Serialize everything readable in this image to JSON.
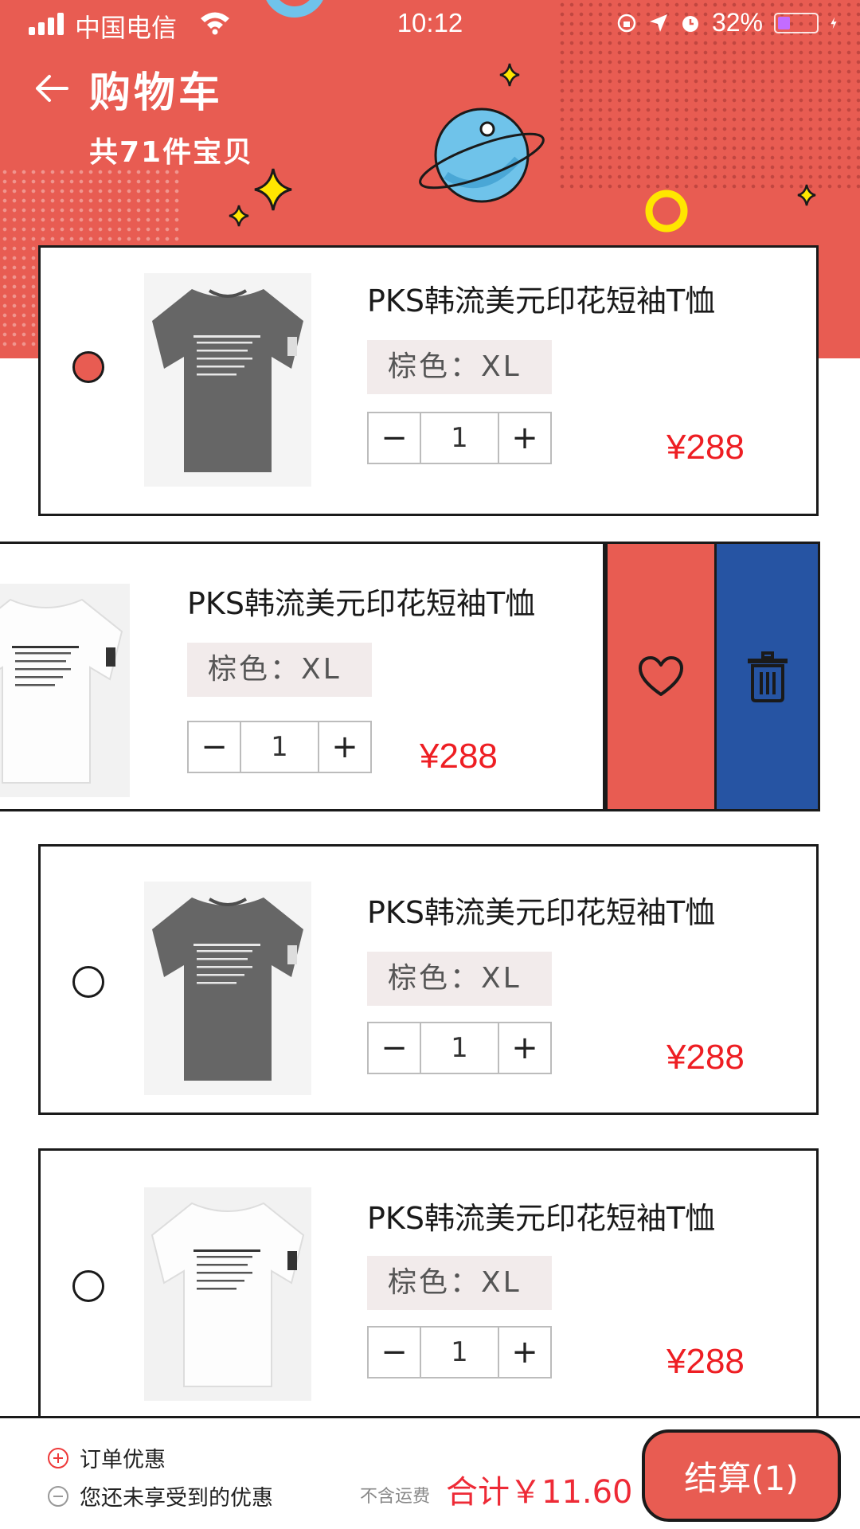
{
  "status_bar": {
    "carrier": "中国电信",
    "time": "10:12",
    "battery": "32%"
  },
  "header": {
    "title": "购物车",
    "subtitle": "共71件宝贝"
  },
  "items": [
    {
      "title": "PKS韩流美元印花短袖T恤",
      "spec": "棕色：XL",
      "qty": "1",
      "price": "¥288",
      "checked": true,
      "shirt_color": "grey"
    },
    {
      "title": "PKS韩流美元印花短袖T恤",
      "spec": "棕色：XL",
      "qty": "1",
      "price": "¥288",
      "checked": false,
      "shirt_color": "white",
      "swiped": true
    },
    {
      "title": "PKS韩流美元印花短袖T恤",
      "spec": "棕色：XL",
      "qty": "1",
      "price": "¥288",
      "checked": false,
      "shirt_color": "grey"
    },
    {
      "title": "PKS韩流美元印花短袖T恤",
      "spec": "棕色：XL",
      "qty": "1",
      "price": "¥288",
      "checked": false,
      "shirt_color": "white"
    }
  ],
  "stepper": {
    "minus": "−",
    "plus": "+"
  },
  "swipe_actions": {
    "favorite_icon": "heart-icon",
    "delete_icon": "trash-icon"
  },
  "bottom_bar": {
    "promo_order": "订单优惠",
    "promo_unused": "您还未享受到的优惠",
    "shipping_note": "不含运费",
    "total": "合计￥11.60",
    "checkout_label": "结算(1)"
  },
  "colors": {
    "brand_red": "#e85c52",
    "price_red": "#ee1e23",
    "delete_blue": "#2654a3"
  }
}
